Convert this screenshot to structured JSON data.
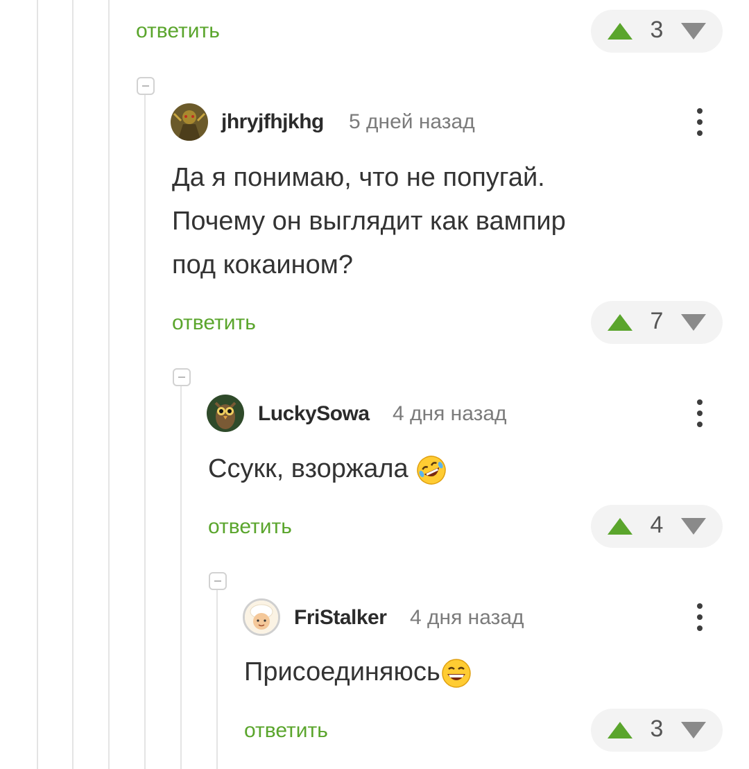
{
  "top_reply": {
    "reply_label": "ответить",
    "rating": "3"
  },
  "comments": [
    {
      "username": "jhryjfhjkhg",
      "time": "5 дней назад",
      "text_lines": [
        "Да я понимаю, что не попугай.",
        "Почему он выглядит как вампир",
        "под кокаином?"
      ],
      "reply_label": "ответить",
      "rating": "7"
    },
    {
      "username": "LuckySowa",
      "time": "4 дня назад",
      "text": "Ссукк, взоржала",
      "emoji": "rolling-on-floor-laughing",
      "reply_label": "ответить",
      "rating": "4"
    },
    {
      "username": "FriStalker",
      "time": "4 дня назад",
      "text": "Присоединяюсь",
      "emoji": "grinning-face",
      "reply_label": "ответить",
      "rating": "3"
    }
  ],
  "colors": {
    "accent": "#5aa52c",
    "thread_line": "#e4e4e4",
    "vote_bg": "#f3f3f3"
  }
}
